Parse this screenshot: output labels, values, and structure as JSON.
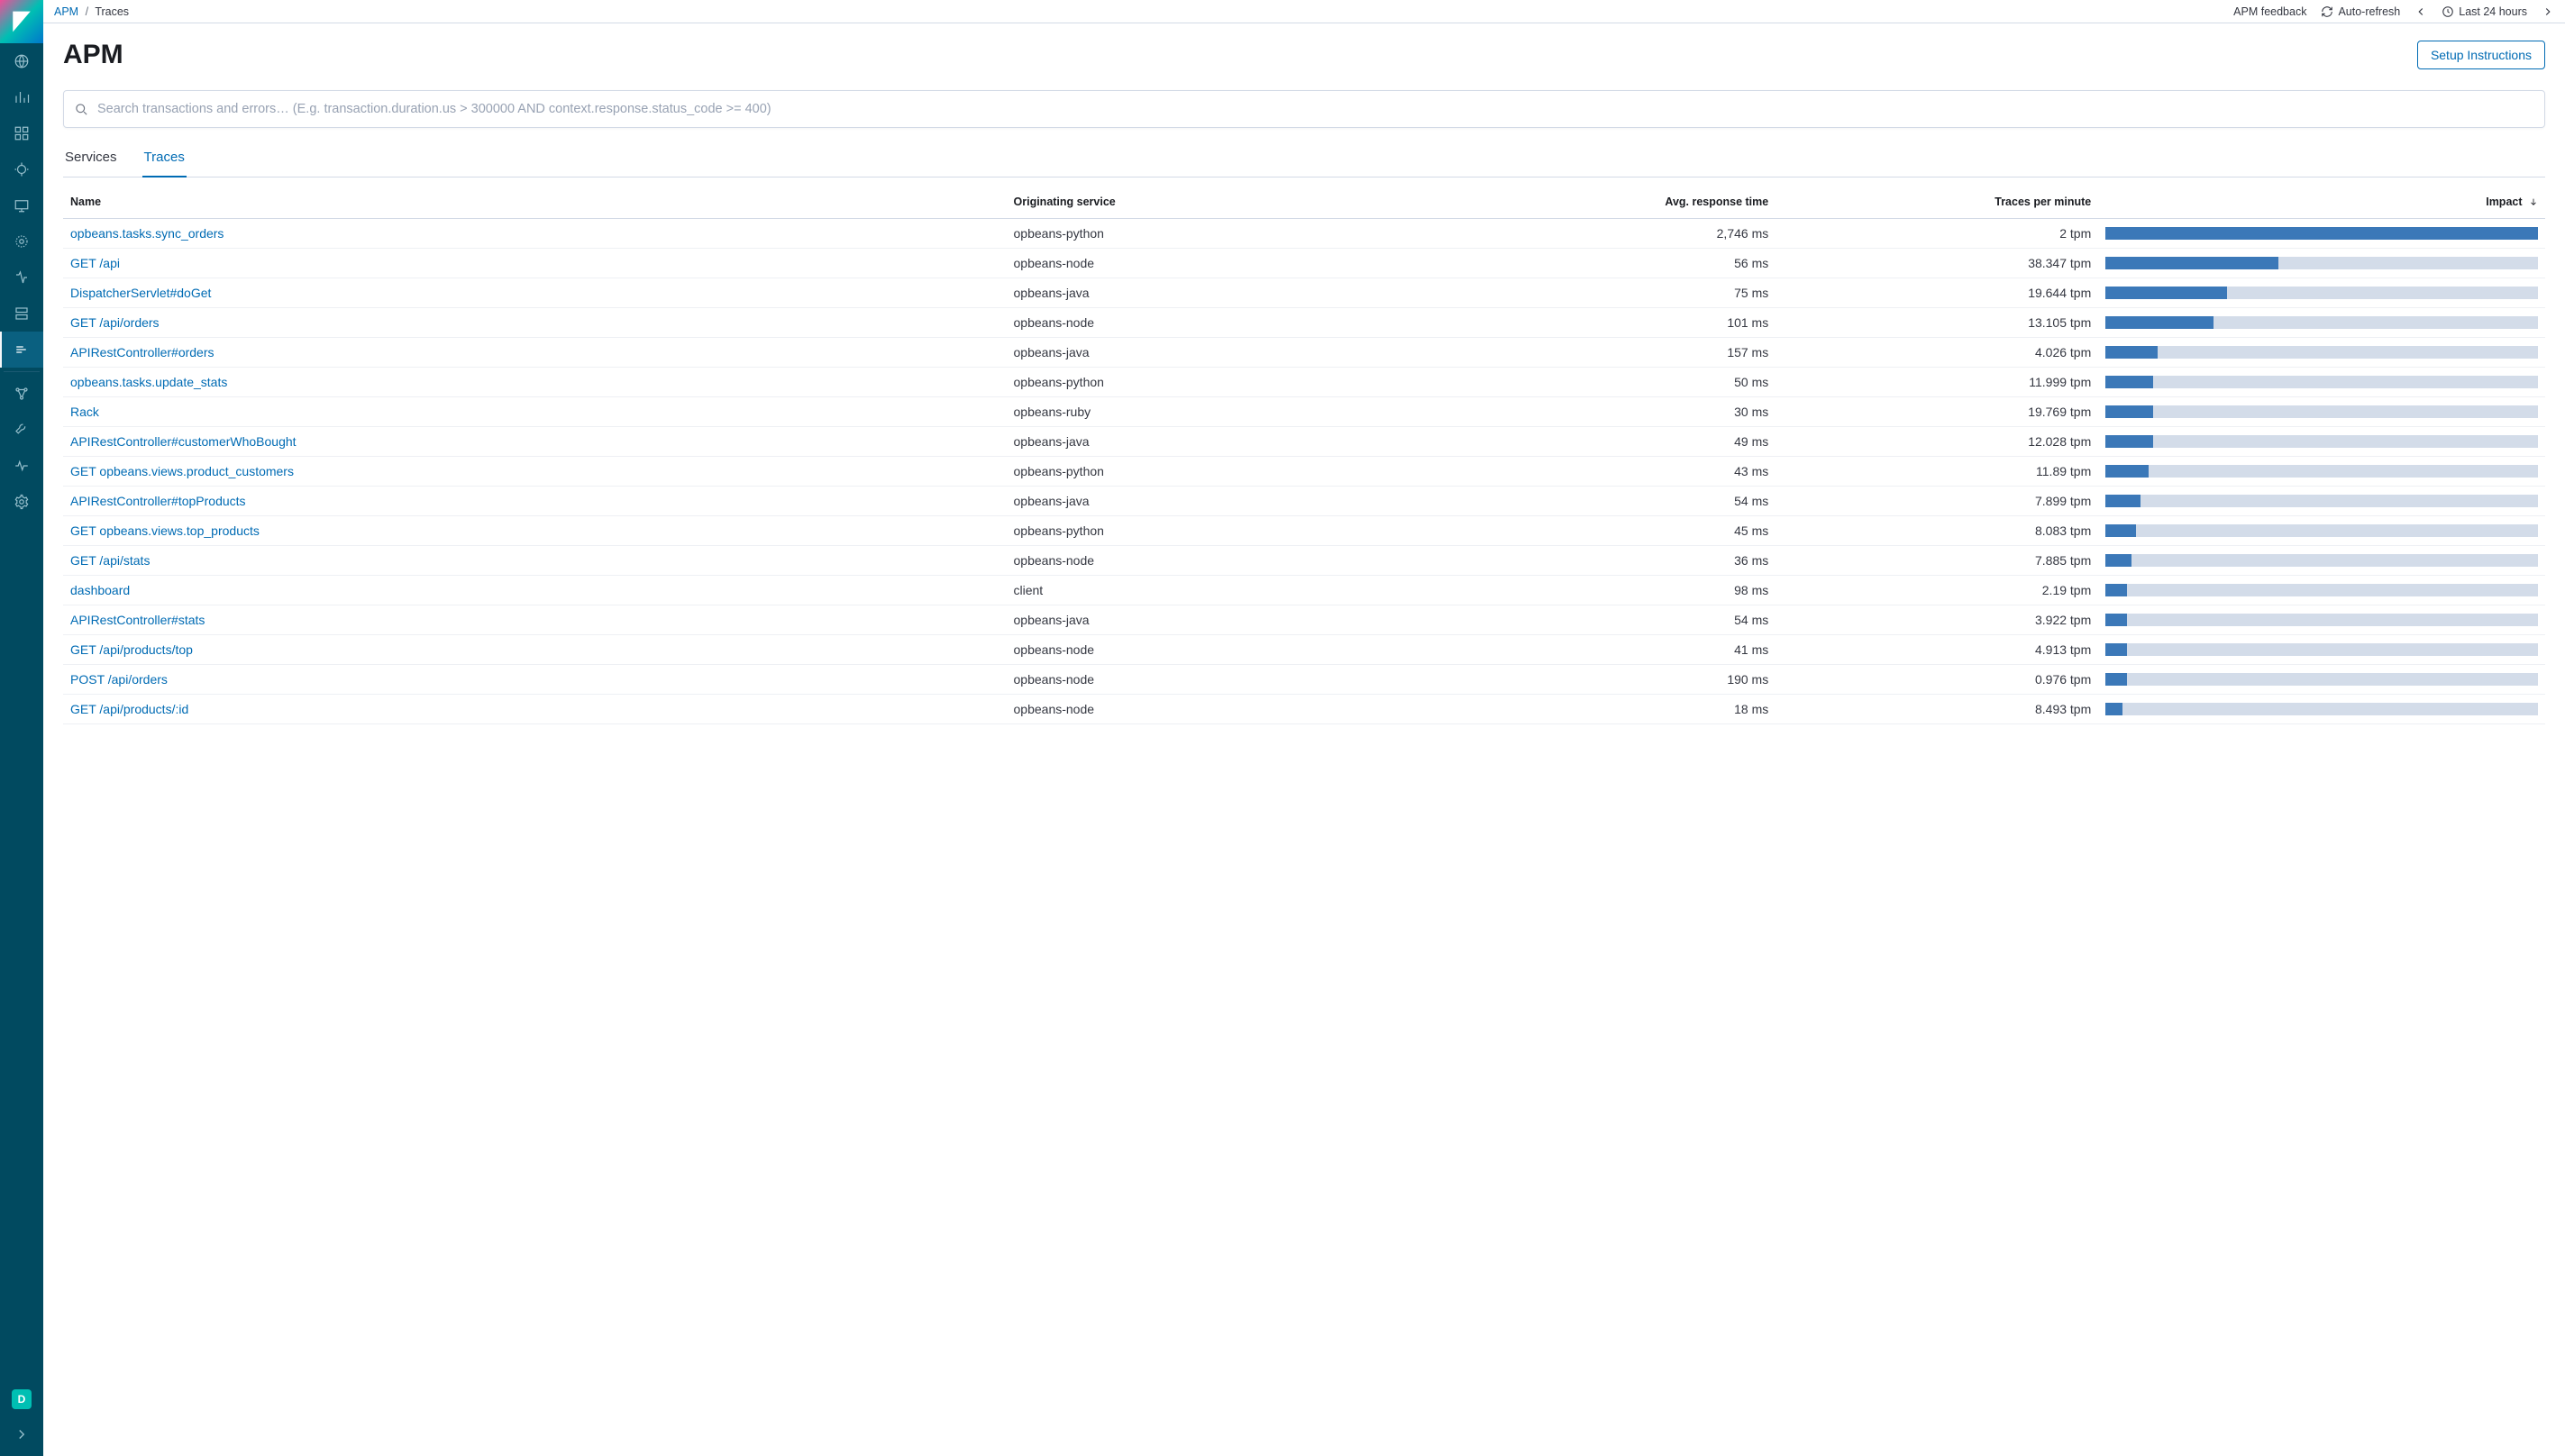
{
  "sidebar": {
    "badge_letter": "D"
  },
  "topbar": {
    "breadcrumb_root": "APM",
    "breadcrumb_current": "Traces",
    "feedback": "APM feedback",
    "auto_refresh": "Auto-refresh",
    "time_range": "Last 24 hours"
  },
  "header": {
    "page_title": "APM",
    "setup_button": "Setup Instructions"
  },
  "search": {
    "placeholder": "Search transactions and errors… (E.g. transaction.duration.us > 300000 AND context.response.status_code >= 400)"
  },
  "tabs": {
    "services": "Services",
    "traces": "Traces"
  },
  "table": {
    "headers": {
      "name": "Name",
      "service": "Originating service",
      "response": "Avg. response time",
      "tpm": "Traces per minute",
      "impact": "Impact"
    },
    "rows": [
      {
        "name": "opbeans.tasks.sync_orders",
        "service": "opbeans-python",
        "response": "2,746 ms",
        "tpm": "2 tpm",
        "impact": 100
      },
      {
        "name": "GET /api",
        "service": "opbeans-node",
        "response": "56 ms",
        "tpm": "38.347 tpm",
        "impact": 40
      },
      {
        "name": "DispatcherServlet#doGet",
        "service": "opbeans-java",
        "response": "75 ms",
        "tpm": "19.644 tpm",
        "impact": 28
      },
      {
        "name": "GET /api/orders",
        "service": "opbeans-node",
        "response": "101 ms",
        "tpm": "13.105 tpm",
        "impact": 25
      },
      {
        "name": "APIRestController#orders",
        "service": "opbeans-java",
        "response": "157 ms",
        "tpm": "4.026 tpm",
        "impact": 12
      },
      {
        "name": "opbeans.tasks.update_stats",
        "service": "opbeans-python",
        "response": "50 ms",
        "tpm": "11.999 tpm",
        "impact": 11
      },
      {
        "name": "Rack",
        "service": "opbeans-ruby",
        "response": "30 ms",
        "tpm": "19.769 tpm",
        "impact": 11
      },
      {
        "name": "APIRestController#customerWhoBought",
        "service": "opbeans-java",
        "response": "49 ms",
        "tpm": "12.028 tpm",
        "impact": 11
      },
      {
        "name": "GET opbeans.views.product_customers",
        "service": "opbeans-python",
        "response": "43 ms",
        "tpm": "11.89 tpm",
        "impact": 10
      },
      {
        "name": "APIRestController#topProducts",
        "service": "opbeans-java",
        "response": "54 ms",
        "tpm": "7.899 tpm",
        "impact": 8
      },
      {
        "name": "GET opbeans.views.top_products",
        "service": "opbeans-python",
        "response": "45 ms",
        "tpm": "8.083 tpm",
        "impact": 7
      },
      {
        "name": "GET /api/stats",
        "service": "opbeans-node",
        "response": "36 ms",
        "tpm": "7.885 tpm",
        "impact": 6
      },
      {
        "name": "dashboard",
        "service": "client",
        "response": "98 ms",
        "tpm": "2.19 tpm",
        "impact": 5
      },
      {
        "name": "APIRestController#stats",
        "service": "opbeans-java",
        "response": "54 ms",
        "tpm": "3.922 tpm",
        "impact": 5
      },
      {
        "name": "GET /api/products/top",
        "service": "opbeans-node",
        "response": "41 ms",
        "tpm": "4.913 tpm",
        "impact": 5
      },
      {
        "name": "POST /api/orders",
        "service": "opbeans-node",
        "response": "190 ms",
        "tpm": "0.976 tpm",
        "impact": 5
      },
      {
        "name": "GET /api/products/:id",
        "service": "opbeans-node",
        "response": "18 ms",
        "tpm": "8.493 tpm",
        "impact": 4
      }
    ]
  }
}
